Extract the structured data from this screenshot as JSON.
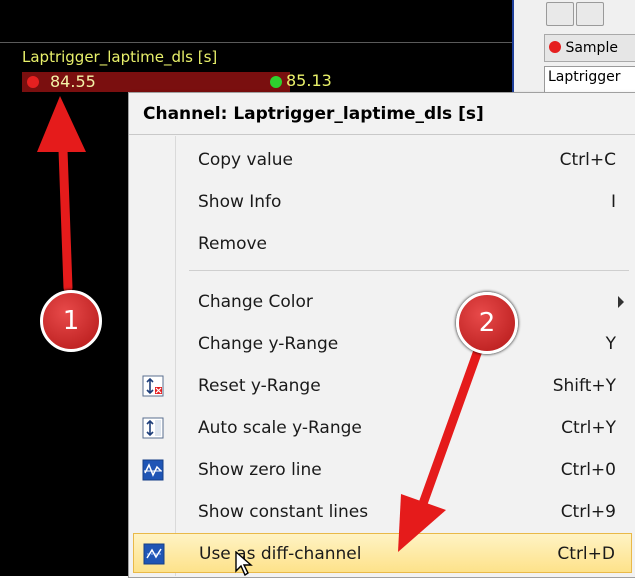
{
  "plot": {
    "channel_name": "Laptrigger_laptime_dls [s]",
    "value_a": "84.55",
    "value_b": "85.13",
    "dot_a_color": "#e52020",
    "dot_b_color": "#2ed12e"
  },
  "right_panel": {
    "sample_label": "Sample",
    "list_first_item": "Laptrigger"
  },
  "menu": {
    "header": "Channel:  Laptrigger_laptime_dls [s]",
    "items": [
      {
        "label": "Copy value",
        "shortcut": "Ctrl+C",
        "icon": ""
      },
      {
        "label": "Show Info",
        "shortcut": "I",
        "icon": ""
      },
      {
        "label": "Remove",
        "shortcut": "",
        "icon": ""
      },
      {
        "label": "Change Color",
        "shortcut": "",
        "icon": "submenu-arrow"
      },
      {
        "label": "Change y-Range",
        "shortcut": "Y",
        "icon": ""
      },
      {
        "label": "Reset y-Range",
        "shortcut": "Shift+Y",
        "icon": "reset-y-range-icon"
      },
      {
        "label": "Auto scale y-Range",
        "shortcut": "Ctrl+Y",
        "icon": "auto-scale-icon"
      },
      {
        "label": "Show zero line",
        "shortcut": "Ctrl+0",
        "icon": "zero-line-icon"
      },
      {
        "label": "Show constant lines",
        "shortcut": "Ctrl+9",
        "icon": ""
      },
      {
        "label": "Use as diff-channel",
        "shortcut": "Ctrl+D",
        "icon": "diff-channel-icon"
      }
    ],
    "highlighted_item": "Use as diff-channel"
  },
  "annotations": {
    "callout_1": "1",
    "callout_2": "2",
    "arrow_color": "#e51b1b"
  }
}
